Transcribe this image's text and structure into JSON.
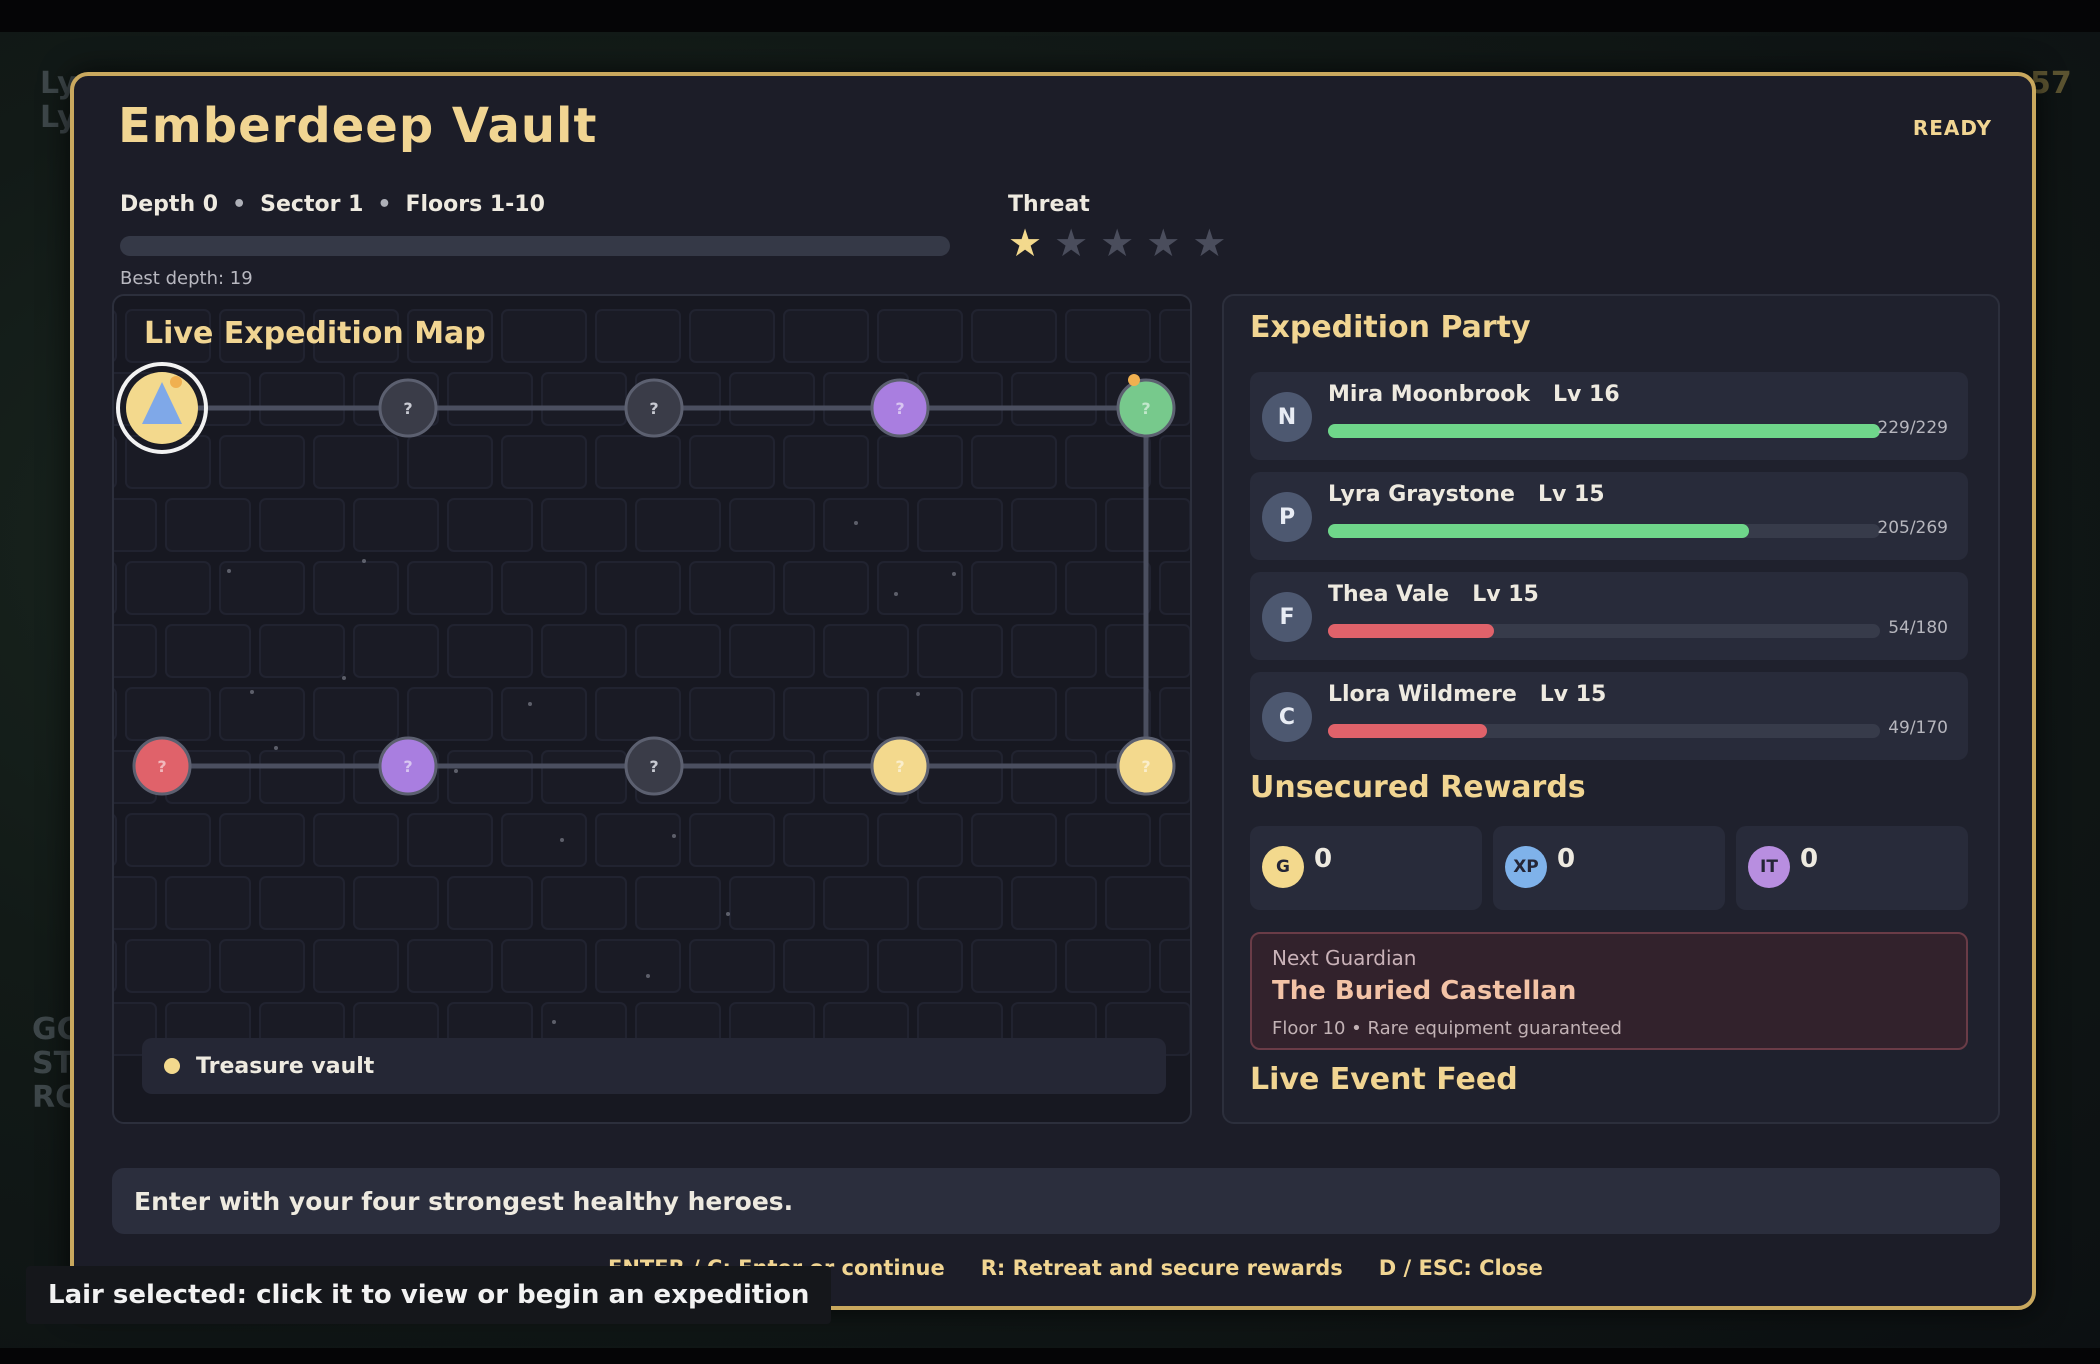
{
  "background": {
    "hud_left_top": [
      "Ly",
      "Ly"
    ],
    "hud_left_bottom": [
      "GC",
      "ST",
      "RC"
    ],
    "gold_value": "57"
  },
  "modal": {
    "title": "Emberdeep Vault",
    "status": "READY",
    "depth": "Depth 0",
    "sector": "Sector 1",
    "floors": "Floors 1-10",
    "separator": "•",
    "best_depth": "Best depth: 19",
    "depth_progress": 0,
    "threat_label": "Threat",
    "threat_level": 1,
    "threat_max": 5
  },
  "map": {
    "title": "Live Expedition Map",
    "legend_text": "Treasure vault",
    "node_glyph": "?",
    "nodes": [
      {
        "row": 0,
        "col": 0,
        "type": "current",
        "color": "#f3d98d"
      },
      {
        "row": 0,
        "col": 1,
        "type": "unknown",
        "color": "#3a3c48"
      },
      {
        "row": 0,
        "col": 2,
        "type": "unknown",
        "color": "#3a3c48"
      },
      {
        "row": 0,
        "col": 3,
        "type": "elite",
        "color": "#a97ee0"
      },
      {
        "row": 0,
        "col": 4,
        "type": "rest",
        "color": "#77c98c"
      },
      {
        "row": 1,
        "col": 4,
        "type": "treasure",
        "color": "#f3d98d"
      },
      {
        "row": 1,
        "col": 3,
        "type": "treasure",
        "color": "#f3d98d"
      },
      {
        "row": 1,
        "col": 2,
        "type": "unknown",
        "color": "#3a3c48"
      },
      {
        "row": 1,
        "col": 1,
        "type": "elite",
        "color": "#a97ee0"
      },
      {
        "row": 1,
        "col": 0,
        "type": "combat",
        "color": "#e0626a"
      }
    ]
  },
  "party": {
    "title": "Expedition Party",
    "heroes": [
      {
        "initial": "N",
        "name": "Mira Moonbrook",
        "level": "Lv 16",
        "hp_text": "229/229",
        "hp": 229,
        "max": 229,
        "color": "#6fd68a"
      },
      {
        "initial": "P",
        "name": "Lyra Graystone",
        "level": "Lv 15",
        "hp_text": "205/269",
        "hp": 205,
        "max": 269,
        "color": "#6fd68a"
      },
      {
        "initial": "F",
        "name": "Thea Vale",
        "level": "Lv 15",
        "hp_text": "54/180",
        "hp": 54,
        "max": 180,
        "color": "#e0626a"
      },
      {
        "initial": "C",
        "name": "Llora Wildmere",
        "level": "Lv 15",
        "hp_text": "49/170",
        "hp": 49,
        "max": 170,
        "color": "#e0626a"
      }
    ]
  },
  "rewards": {
    "title": "Unsecured Rewards",
    "items": [
      {
        "icon": "G",
        "value": "0",
        "color": "#f3d98d"
      },
      {
        "icon": "XP",
        "value": "0",
        "color": "#7fb2ea"
      },
      {
        "icon": "IT",
        "value": "0",
        "color": "#b88ee0"
      }
    ]
  },
  "guardian": {
    "label": "Next Guardian",
    "name": "The Buried Castellan",
    "floor": "Floor 10",
    "separator": "•",
    "reward": "Rare equipment guaranteed"
  },
  "feed": {
    "title": "Live Event Feed"
  },
  "message": "Enter with your four strongest healthy heroes.",
  "hints": {
    "enter": "ENTER / C: Enter or continue",
    "retreat": "R: Retreat and secure rewards",
    "close": "D / ESC: Close"
  },
  "lair_tip": "Lair selected: click it to view or begin an expedition",
  "colors": {
    "gold": "#f1d592",
    "frame": "#c9a85e",
    "panel": "#1f212d",
    "hp_good": "#6fd68a",
    "hp_low": "#e0626a"
  }
}
